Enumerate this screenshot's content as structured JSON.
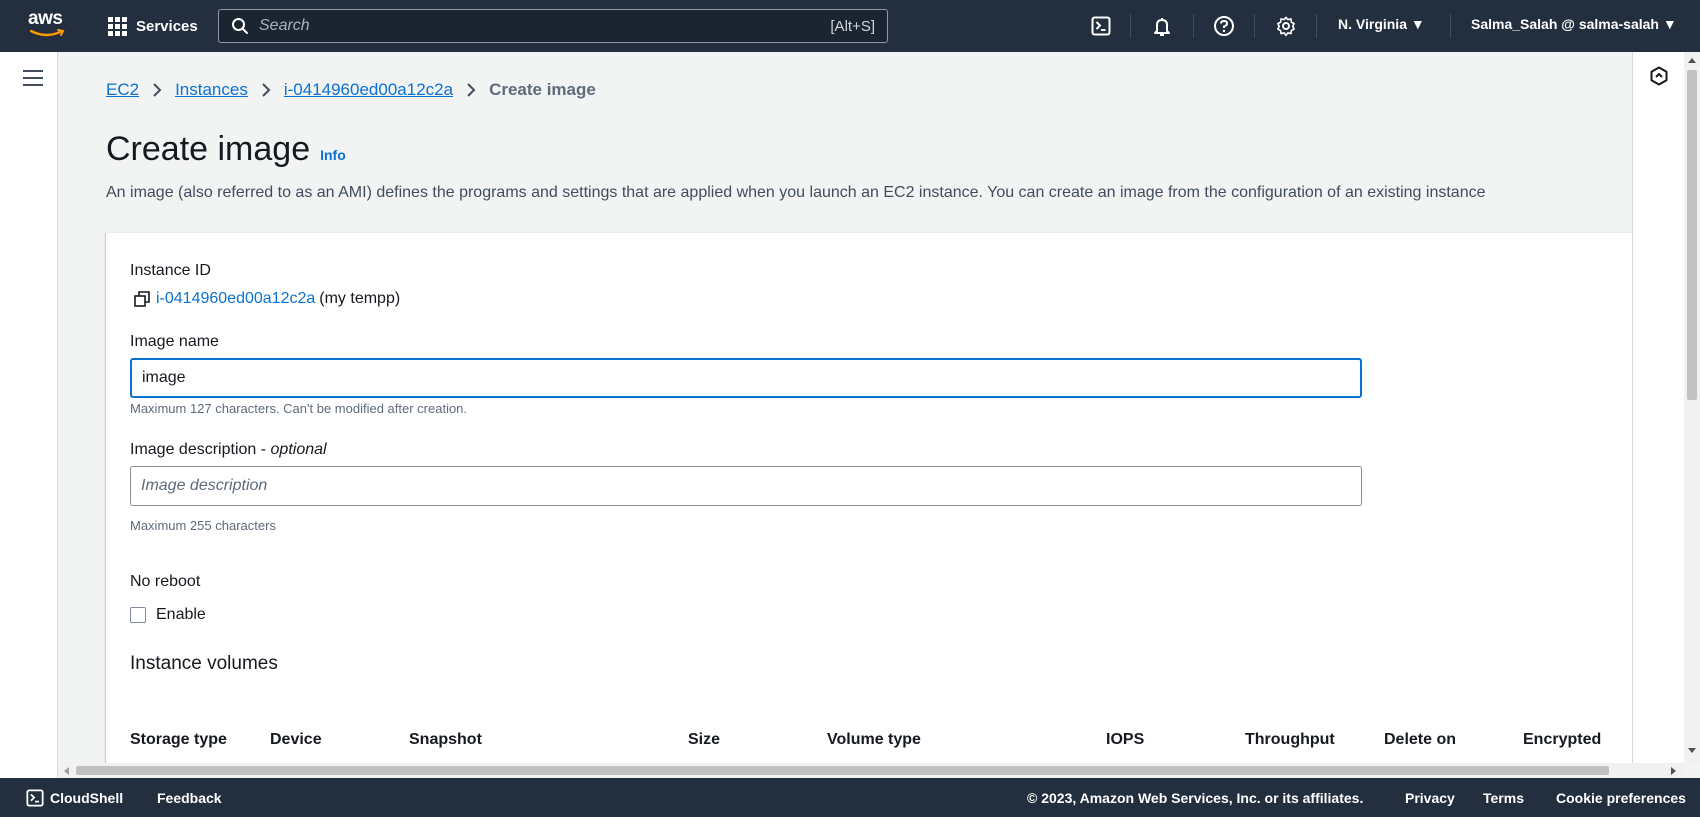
{
  "topnav": {
    "logo_text": "aws",
    "services_label": "Services",
    "search_placeholder": "Search",
    "search_shortcut": "[Alt+S]",
    "region_label": "N. Virginia ▼",
    "account_label": "Salma_Salah @ salma-salah ▼"
  },
  "breadcrumb": {
    "items": [
      "EC2",
      "Instances",
      "i-0414960ed00a12c2a"
    ],
    "current": "Create image"
  },
  "page": {
    "title": "Create image",
    "info_link": "Info",
    "description": "An image (also referred to as an AMI) defines the programs and settings that are applied when you launch an EC2 instance. You can create an image from the configuration of an existing instance"
  },
  "form": {
    "instance_id_label": "Instance ID",
    "instance_id_value": "i-0414960ed00a12c2a",
    "instance_name_tag": "(my tempp)",
    "image_name_label": "Image name",
    "image_name_value": "image",
    "image_name_hint": "Maximum 127 characters. Can't be modified after creation.",
    "image_desc_label": "Image description - ",
    "image_desc_optional": "optional",
    "image_desc_placeholder": "Image description",
    "image_desc_hint": "Maximum 255 characters",
    "no_reboot_label": "No reboot",
    "enable_label": "Enable",
    "volumes_title": "Instance volumes",
    "volume_columns": [
      "Storage type",
      "Device",
      "Snapshot",
      "Size",
      "Volume type",
      "IOPS",
      "Throughput",
      "Delete on",
      "Encrypted"
    ]
  },
  "footer": {
    "cloudshell": "CloudShell",
    "feedback": "Feedback",
    "copyright": "© 2023, Amazon Web Services, Inc. or its affiliates.",
    "privacy": "Privacy",
    "terms": "Terms",
    "cookie": "Cookie preferences"
  },
  "colors": {
    "nav_bg": "#232f3e",
    "link": "#0972d3",
    "aws_orange": "#ff9900"
  }
}
